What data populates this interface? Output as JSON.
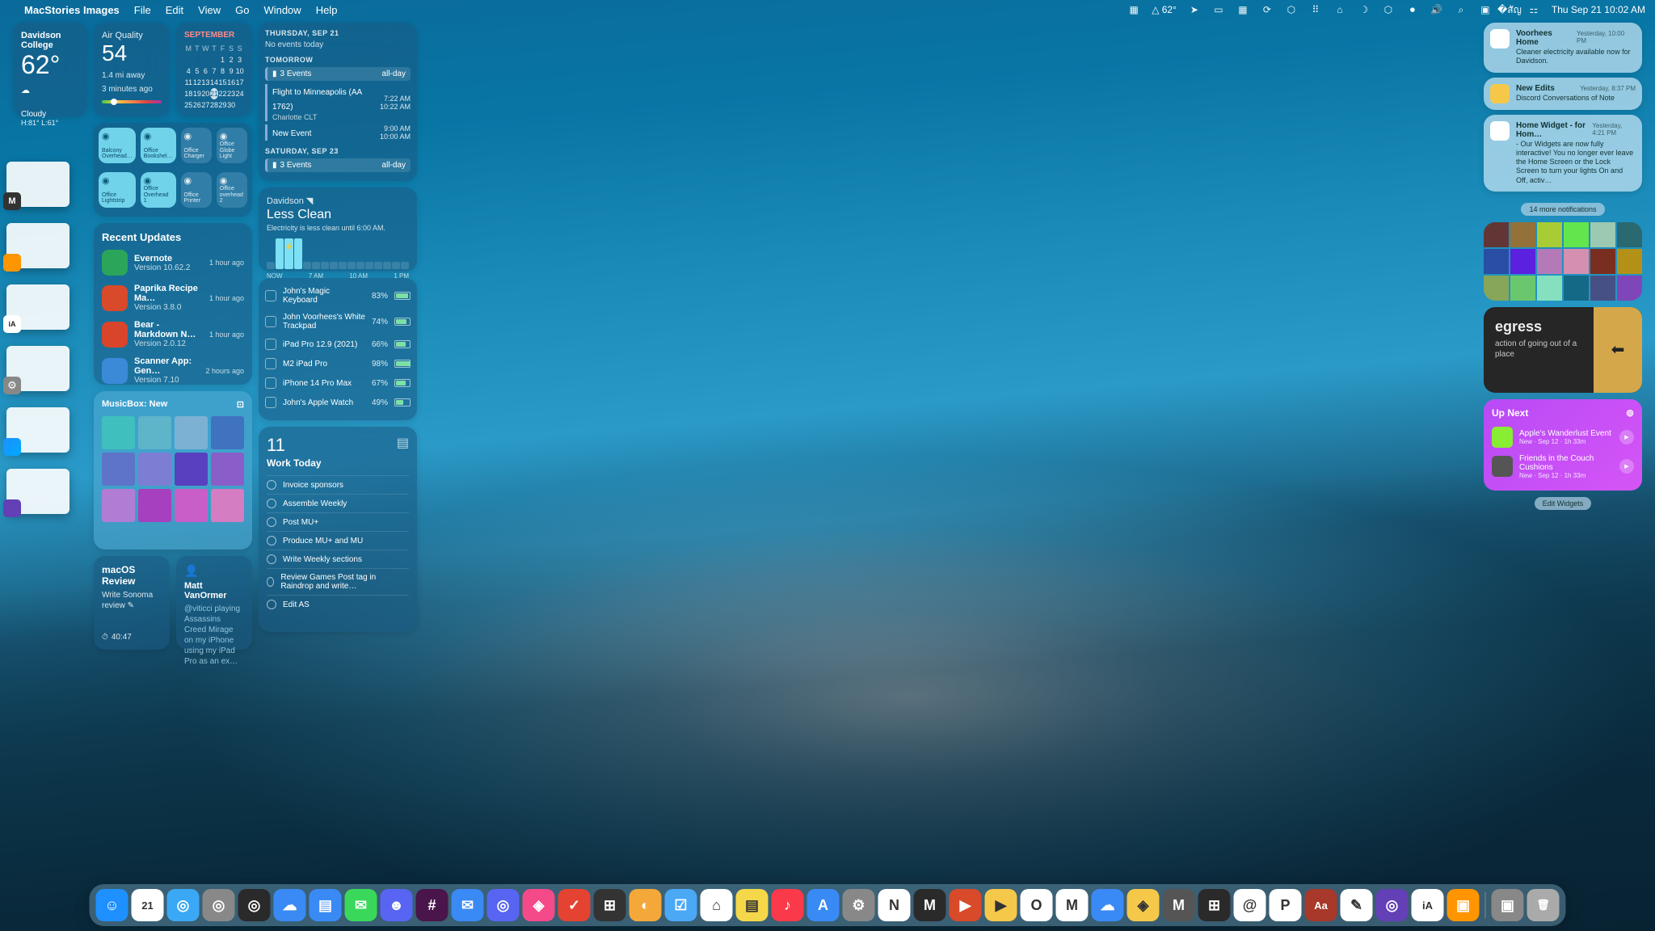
{
  "menubar": {
    "app": "MacStories Images",
    "items": [
      "File",
      "Edit",
      "View",
      "Go",
      "Window",
      "Help"
    ],
    "right_temp": "△ 62°",
    "datetime": "Thu Sep 21  10:02 AM"
  },
  "weather": {
    "location": "Davidson College",
    "temp": "62°",
    "icon": "☁︎",
    "condition": "Cloudy",
    "hilo": "H:81° L:61°"
  },
  "aqi": {
    "label": "Air Quality",
    "value": "54",
    "distance": "1.4 mi away",
    "ago": "3 minutes ago"
  },
  "calendar": {
    "month": "SEPTEMBER",
    "days": [
      "M",
      "T",
      "W",
      "T",
      "F",
      "S",
      "S"
    ],
    "today": 21
  },
  "home_tiles": [
    {
      "name": "Balcony Overhead…",
      "on": true
    },
    {
      "name": "Office Bookshel…",
      "on": true
    },
    {
      "name": "Office Charger",
      "on": false
    },
    {
      "name": "Office Globe Light",
      "on": false
    },
    {
      "name": "Office Lightstrip",
      "on": true
    },
    {
      "name": "Office Overhead 1",
      "on": true
    },
    {
      "name": "Office Printer",
      "on": false
    },
    {
      "name": "Office overhead 2",
      "on": false
    }
  ],
  "updates": {
    "title": "Recent Updates",
    "items": [
      {
        "name": "Evernote",
        "ver": "Version 10.62.2",
        "ago": "1 hour ago",
        "color": "#2aa55a"
      },
      {
        "name": "Paprika Recipe Ma…",
        "ver": "Version 3.8.0",
        "ago": "1 hour ago",
        "color": "#d84a2a"
      },
      {
        "name": "Bear - Markdown N…",
        "ver": "Version 2.0.12",
        "ago": "1 hour ago",
        "color": "#d8452a"
      },
      {
        "name": "Scanner App: Gen…",
        "ver": "Version 7.10",
        "ago": "2 hours ago",
        "color": "#3a8ad8"
      }
    ]
  },
  "musicbox": {
    "title": "MusicBox: New"
  },
  "note1": {
    "title": "macOS Review",
    "body": "Write Sonoma review ✎",
    "meta": "40:47"
  },
  "note2": {
    "author": "Matt VanOrmer",
    "body": "@viticci playing Assassins Creed Mirage on my iPhone using my iPad Pro as an ex…"
  },
  "events": {
    "d1": "THURSDAY, SEP 21",
    "d1_none": "No events today",
    "d2": "TOMORROW",
    "d2_count": "3 Events",
    "d2_allday": "all-day",
    "e1": {
      "name": "Flight to Minneapolis (AA 1762)",
      "sub": "Charlotte CLT",
      "t1": "7:22 AM",
      "t2": "10:22 AM"
    },
    "e2": {
      "name": "New Event",
      "t1": "9:00 AM",
      "t2": "10:00 AM"
    },
    "d3": "SATURDAY, SEP 23",
    "d3_count": "3 Events",
    "d3_allday": "all-day"
  },
  "elec": {
    "loc": "Davidson ◥",
    "state": "Less Clean",
    "sub": "Electricity is less clean until 6:00 AM.",
    "times": [
      "NOW",
      "7 AM",
      "10 AM",
      "1 PM"
    ]
  },
  "batteries": [
    {
      "name": "John's Magic Keyboard",
      "pct": "83%",
      "p": 83
    },
    {
      "name": "John Voorhees's White Trackpad",
      "pct": "74%",
      "p": 74
    },
    {
      "name": "iPad Pro 12.9 (2021)",
      "pct": "66%",
      "p": 66
    },
    {
      "name": "M2 iPad Pro",
      "pct": "98%",
      "p": 98
    },
    {
      "name": "iPhone 14 Pro Max",
      "pct": "67%",
      "p": 67
    },
    {
      "name": "John's Apple Watch",
      "pct": "49%",
      "p": 49
    }
  ],
  "todo": {
    "count": "11",
    "title": "Work Today",
    "items": [
      "Invoice sponsors",
      "Assemble Weekly",
      "Post MU+",
      "Produce MU+ and MU",
      "Write Weekly sections",
      "Review Games Post tag in Raindrop and write…",
      "Edit AS"
    ]
  },
  "notifs": [
    {
      "title": "Voorhees Home",
      "when": "Yesterday, 10:00 PM",
      "body": "Cleaner electricity available now for Davidson.",
      "color": "#fff"
    },
    {
      "title": "New Edits",
      "when": "Yesterday, 8:37 PM",
      "body": "Discord Conversations of Note",
      "color": "#f5c84a"
    },
    {
      "title": "Home Widget - for Hom…",
      "when": "Yesterday, 4:21 PM",
      "body": "- Our Widgets are now fully interactive! You no longer ever leave the Home Screen or the Lock Screen to turn your lights On and Off, activ…",
      "color": "#fff"
    }
  ],
  "more": "14 more notifications",
  "word": {
    "w": "egress",
    "def": "action of going out of a place"
  },
  "upnext": {
    "title": "Up Next",
    "items": [
      {
        "name": "Apple's Wanderlust Event",
        "meta": "New · Sep 12 · 1h 33m"
      },
      {
        "name": "Friends in the Couch Cushions",
        "meta": "New · Sep 12 · 1h 33m"
      }
    ]
  },
  "edit": "Edit Widgets",
  "dock_apps": [
    {
      "n": "finder",
      "c": "#1e90ff",
      "t": "☺"
    },
    {
      "n": "calendar",
      "c": "#fff",
      "t": "21"
    },
    {
      "n": "safari",
      "c": "#3aa8f5",
      "t": "◎"
    },
    {
      "n": "orion",
      "c": "#888",
      "t": "◎"
    },
    {
      "n": "obsidian",
      "c": "#2a2a2a",
      "t": "◎"
    },
    {
      "n": "mail-b",
      "c": "#3a8af5",
      "t": "☁"
    },
    {
      "n": "files",
      "c": "#3a8af5",
      "t": "▤"
    },
    {
      "n": "messages",
      "c": "#3ad85a",
      "t": "✉"
    },
    {
      "n": "discord",
      "c": "#5865f2",
      "t": "☻"
    },
    {
      "n": "slack",
      "c": "#4a154b",
      "t": "#"
    },
    {
      "n": "mail",
      "c": "#3a8af5",
      "t": "✉"
    },
    {
      "n": "discord2",
      "c": "#5865f2",
      "t": "◎"
    },
    {
      "n": "shortcuts",
      "c": "#f54a8a",
      "t": "◈"
    },
    {
      "n": "todoist",
      "c": "#e44332",
      "t": "✓"
    },
    {
      "n": "fantastical",
      "c": "#333",
      "t": "⊞"
    },
    {
      "n": "timery",
      "c": "#f5a83a",
      "t": "◐"
    },
    {
      "n": "things",
      "c": "#4aa8f5",
      "t": "☑"
    },
    {
      "n": "home",
      "c": "#fff",
      "t": "⌂"
    },
    {
      "n": "notes",
      "c": "#f5d84a",
      "t": "▤"
    },
    {
      "n": "music",
      "c": "#fa3a4a",
      "t": "♪"
    },
    {
      "n": "appstore",
      "c": "#3a8af5",
      "t": "A"
    },
    {
      "n": "settings",
      "c": "#888",
      "t": "⚙"
    },
    {
      "n": "notion",
      "c": "#fff",
      "t": "N"
    },
    {
      "n": "m-app",
      "c": "#2a2a2a",
      "t": "M"
    },
    {
      "n": "readwise",
      "c": "#d84a2a",
      "t": "▶"
    },
    {
      "n": "bear",
      "c": "#f5c84a",
      "t": "▶"
    },
    {
      "n": "o-app",
      "c": "#fff",
      "t": "O"
    },
    {
      "n": "m2-app",
      "c": "#fff",
      "t": "M"
    },
    {
      "n": "cloud",
      "c": "#3a8af5",
      "t": "☁"
    },
    {
      "n": "y-app",
      "c": "#f5c84a",
      "t": "◈"
    },
    {
      "n": "m3-app",
      "c": "#555",
      "t": "M"
    },
    {
      "n": "grid",
      "c": "#2a2a2a",
      "t": "⊞"
    },
    {
      "n": "threads",
      "c": "#fff",
      "t": "@"
    },
    {
      "n": "p-app",
      "c": "#fff",
      "t": "P"
    },
    {
      "n": "dict",
      "c": "#a8382a",
      "t": "Aa"
    },
    {
      "n": "freeform",
      "c": "#fff",
      "t": "✎"
    },
    {
      "n": "github",
      "c": "#6340b5",
      "t": "◎"
    },
    {
      "n": "ia",
      "c": "#fff",
      "t": "iA"
    },
    {
      "n": "books",
      "c": "#ff9500",
      "t": "▣"
    },
    {
      "n": "photo",
      "c": "#888",
      "t": "▣"
    },
    {
      "n": "trash",
      "c": "#aaa",
      "t": "🗑"
    }
  ]
}
